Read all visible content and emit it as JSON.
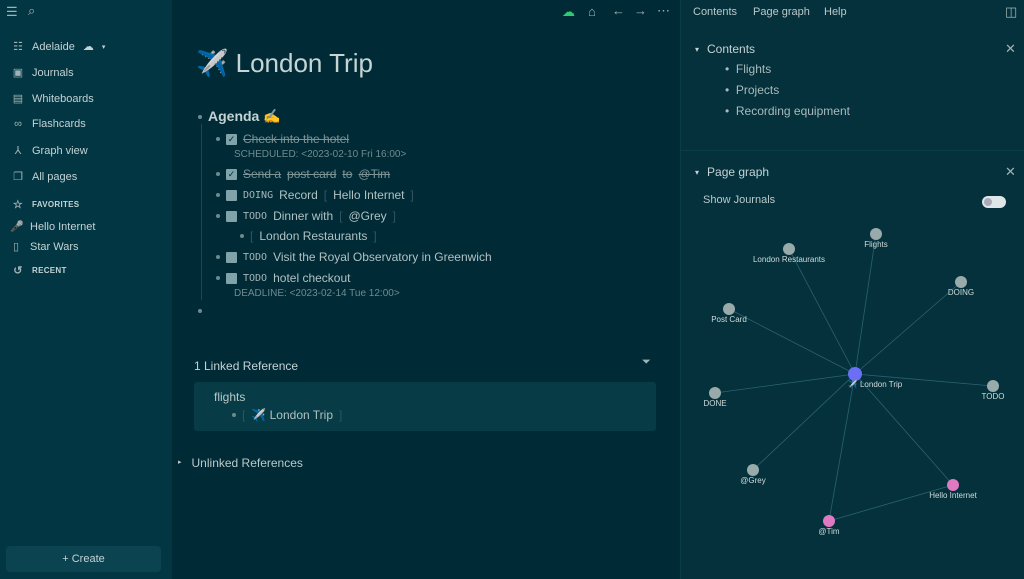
{
  "sidebar": {
    "repo": "Adelaide",
    "nav": [
      "Journals",
      "Whiteboards",
      "Flashcards",
      "Graph view",
      "All pages"
    ],
    "favorites_label": "FAVORITES",
    "favorites": [
      "Hello Internet",
      "Star Wars"
    ],
    "recent_label": "RECENT",
    "create": "+ Create"
  },
  "page": {
    "icon": "✈️",
    "title": "London Trip",
    "agenda": "Agenda ✍️",
    "blocks": {
      "b1": "Check into the hotel",
      "b1_meta": "SCHEDULED: <2023-02-10 Fri 16:00>",
      "b2a": "Send a",
      "b2b": "post card",
      "b2c": "to",
      "b2d": "@Tim",
      "b3kw": "DOING",
      "b3": "Record",
      "b3l": "Hello Internet",
      "b4kw": "TODO",
      "b4": "Dinner with",
      "b4l": "@Grey",
      "b5": "London Restaurants",
      "b6kw": "TODO",
      "b6": "Visit the Royal Observatory in Greenwich",
      "b7kw": "TODO",
      "b7": "hotel checkout",
      "b7_meta": "DEADLINE: <2023-02-14 Tue 12:00>"
    },
    "linked_refs": "1 Linked Reference",
    "ref_page": "flights",
    "ref_item": "✈️ London Trip",
    "unlinked_refs": "Unlinked References"
  },
  "right": {
    "tabs": [
      "Contents",
      "Page graph",
      "Help"
    ],
    "contents_title": "Contents",
    "contents": [
      "Flights",
      "Projects",
      "Recording equipment"
    ],
    "graph_title": "Page graph",
    "show_journals": "Show Journals",
    "nodes": [
      "✈️ London Trip",
      "Flights",
      "London Restaurants",
      "DOING",
      "Post Card",
      "DONE",
      "TODO",
      "@Grey",
      "Hello Internet",
      "@Tim"
    ]
  }
}
